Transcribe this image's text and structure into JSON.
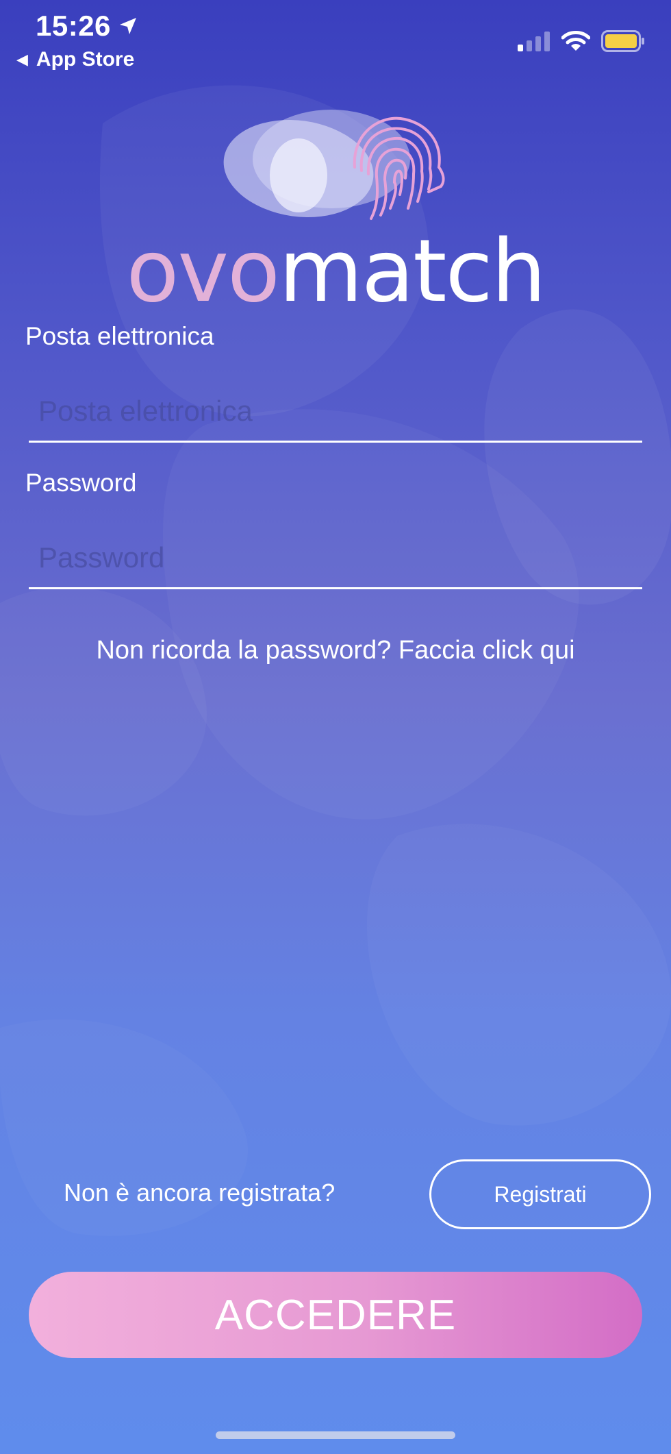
{
  "status_bar": {
    "time": "15:26",
    "back_label": "App Store"
  },
  "logo": {
    "ovo": "ovo",
    "match": "match"
  },
  "form": {
    "email_label": "Posta elettronica",
    "email_placeholder": "Posta elettronica",
    "password_label": "Password",
    "password_placeholder": "Password",
    "forgot_password": "Non ricorda la password? Faccia click qui"
  },
  "footer": {
    "register_prompt": "Non è ancora registrata?",
    "register_button": "Registrati",
    "login_button": "ACCEDERE"
  },
  "colors": {
    "accent_pink": "#e2b1d8",
    "button_gradient_start": "#f2b0dc",
    "button_gradient_end": "#d36dc6",
    "background_top": "#3a3fbe",
    "background_bottom": "#5f8cec",
    "battery": "#f5cf45"
  }
}
